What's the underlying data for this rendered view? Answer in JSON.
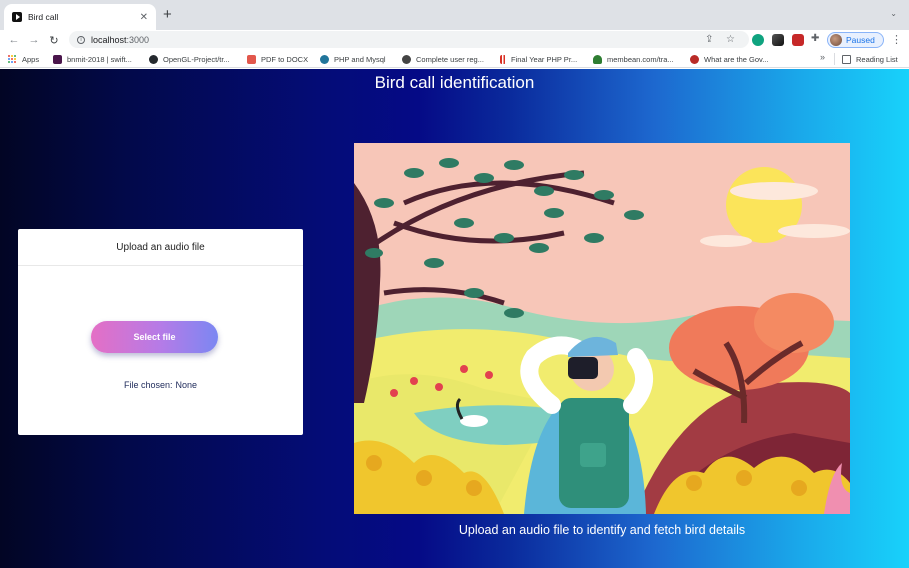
{
  "browser": {
    "tab": {
      "title": "Bird call",
      "close_glyph": "✕",
      "icon": "play-favicon-icon"
    },
    "new_tab_glyph": "+",
    "tab_menu_glyph": "⌄",
    "toolbar": {
      "back_glyph": "←",
      "forward_glyph": "→",
      "reload_glyph": "↻",
      "url_host": "localhost",
      "url_port": ":3000",
      "share_glyph": "⇪",
      "star_glyph": "☆",
      "extensions_glyph": "✚",
      "profile_label": "Paused",
      "menu_glyph": "⋮"
    },
    "bookmarks": [
      {
        "label": "Apps",
        "icon": "apps-grid-icon"
      },
      {
        "label": "bnmit-2018 | swift...",
        "icon": "slack-icon",
        "color": "#4a154b"
      },
      {
        "label": "OpenGL-Project/tr...",
        "icon": "github-icon",
        "color": "#24292e"
      },
      {
        "label": "PDF to DOCX",
        "icon": "pdf-icon",
        "color": "#e2574c"
      },
      {
        "label": "PHP and Mysql",
        "icon": "wordpress-icon",
        "color": "#21759b"
      },
      {
        "label": "Complete user reg...",
        "icon": "globe-icon",
        "color": "#444"
      },
      {
        "label": "Final Year PHP Pr...",
        "icon": "bars-icon",
        "color": "#d93025"
      },
      {
        "label": "membean.com/tra...",
        "icon": "membean-icon",
        "color": "#2e7d32"
      },
      {
        "label": "What are the Gov...",
        "icon": "quora-icon",
        "color": "#b92b27"
      }
    ],
    "bookmarks_overflow": "»",
    "reading_list": "Reading List"
  },
  "page": {
    "title": "Bird call identification",
    "upload_card": {
      "header": "Upload an audio file",
      "select_button": "Select file",
      "file_chosen_label": "File chosen:",
      "file_chosen_value": "None"
    },
    "caption": "Upload an audio file to identify and fetch bird details"
  },
  "colors": {
    "gradient_left": "#020524",
    "gradient_mid": "#050a86",
    "gradient_right": "#18d2fb",
    "button_start": "#e46fc5",
    "button_end": "#7b87f2"
  }
}
